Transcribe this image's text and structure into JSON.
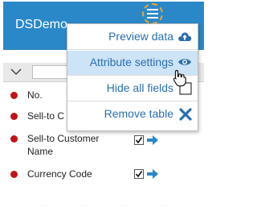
{
  "header": {
    "title": "DSDemo"
  },
  "menu": {
    "items": [
      {
        "label": "Preview data",
        "icon": "cloud-upload-icon"
      },
      {
        "label": "Attribute settings",
        "icon": "eye-icon",
        "active": true
      },
      {
        "label": "Hide all fields",
        "icon": "checkbox-empty-icon"
      },
      {
        "label": "Remove table",
        "icon": "close-x-icon"
      }
    ]
  },
  "fields": [
    {
      "label": "No."
    },
    {
      "label": "Sell-to Customer No."
    },
    {
      "label": "Sell-to Customer Name",
      "checked": true
    },
    {
      "label": "Currency Code",
      "checked": true
    }
  ],
  "colors": {
    "header": "#2b88c8",
    "accent": "#2a6fae",
    "dot": "#c0141a",
    "highlight": "#f5a623"
  }
}
